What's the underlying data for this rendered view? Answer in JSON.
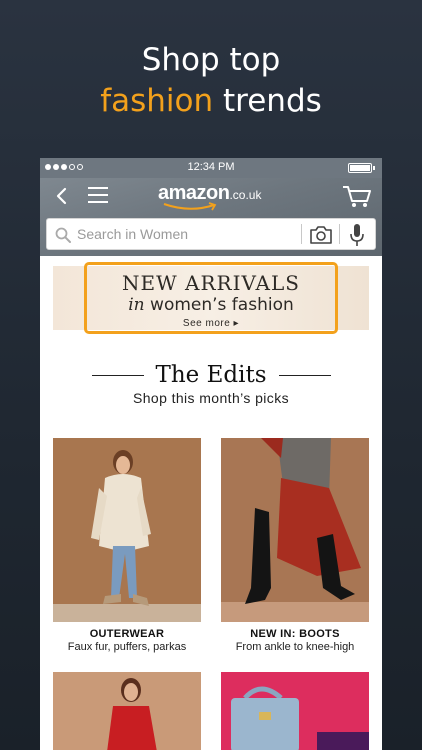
{
  "promo": {
    "line1": "Shop top",
    "line2_accent": "fashion",
    "line2_rest": " trends"
  },
  "status_bar": {
    "time": "12:34 PM"
  },
  "nav": {
    "logo_word": "amazon",
    "logo_tld": ".co.uk",
    "back_icon": "chevron-left-icon",
    "menu_icon": "hamburger-menu-icon",
    "cart_icon": "cart-icon"
  },
  "search": {
    "placeholder": "Search in Women",
    "icons": [
      "search-icon",
      "camera-icon",
      "microphone-icon"
    ]
  },
  "banner": {
    "title": "NEW ARRIVALS",
    "subtitle_italic": "in",
    "subtitle_rest": " women’s fashion",
    "link": "See more ▸"
  },
  "edits": {
    "title": "The Edits",
    "subtitle": "Shop this month’s picks",
    "cards": [
      {
        "label": "OUTERWEAR",
        "desc": "Faux fur, puffers, parkas"
      },
      {
        "label": "NEW IN: BOOTS",
        "desc": "From ankle to knee-high"
      }
    ]
  },
  "colors": {
    "accent": "#f3a11c",
    "background": "#1f2731",
    "nav": "#6e7780"
  }
}
